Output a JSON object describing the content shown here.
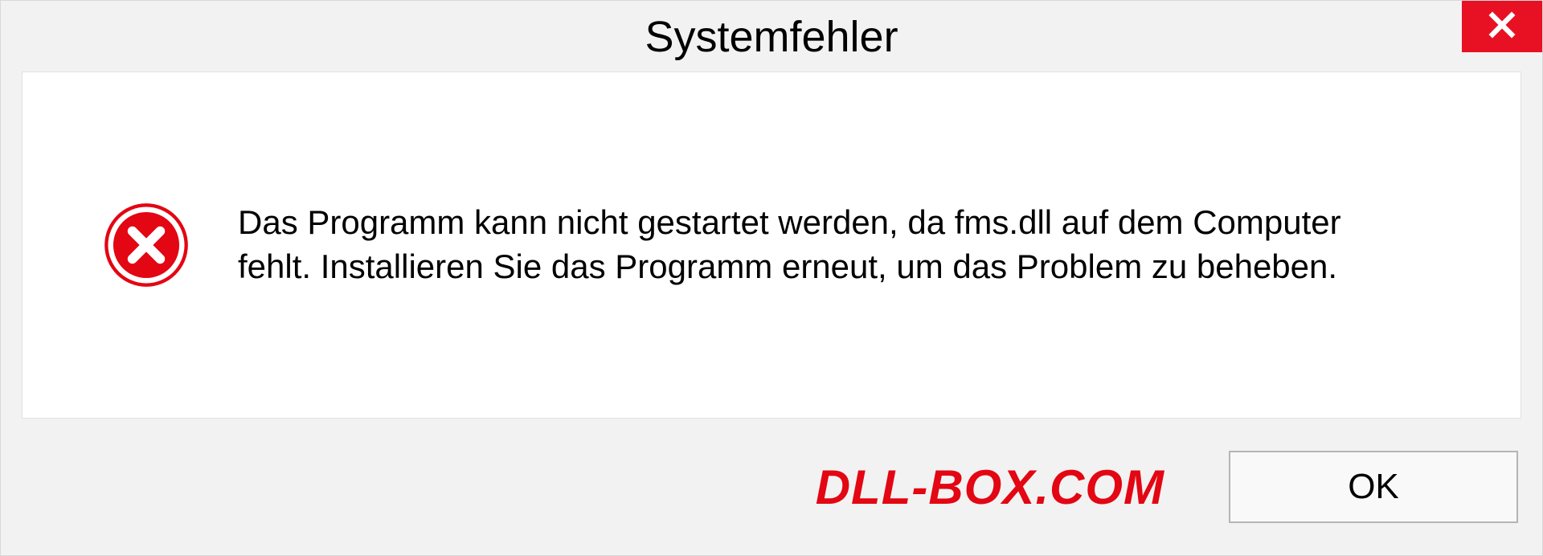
{
  "dialog": {
    "title": "Systemfehler",
    "message": "Das Programm kann nicht gestartet werden, da fms.dll auf dem Computer fehlt. Installieren Sie das Programm erneut, um das Problem zu beheben.",
    "ok_label": "OK"
  },
  "watermark": "DLL-BOX.COM"
}
